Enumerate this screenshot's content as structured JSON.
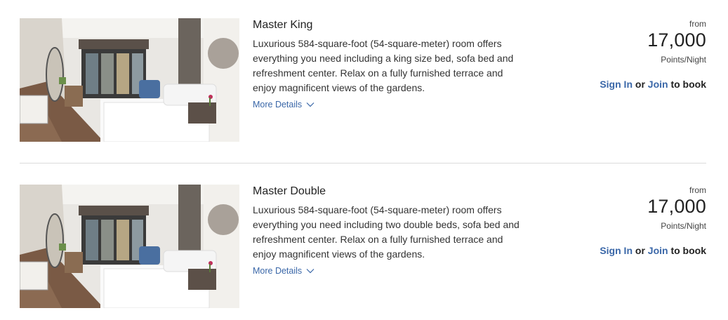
{
  "rooms": [
    {
      "title": "Master King",
      "description": "Luxurious 584-square-foot (54-square-meter) room offers everything you need including a king size bed, sofa bed and refreshment center. Relax on a fully furnished terrace and enjoy magnificent views of the gardens.",
      "more_details": "More Details",
      "price_prefix": "from",
      "price": "17,000",
      "price_unit": "Points/Night",
      "sign_in": "Sign In",
      "or": "or",
      "join": "Join",
      "to_book": "to book"
    },
    {
      "title": "Master Double",
      "description": "Luxurious 584-square-foot (54-square-meter) room offers everything you need including two double beds, sofa bed and refreshment center. Relax on a fully furnished terrace and enjoy magnificent views of the gardens.",
      "more_details": "More Details",
      "price_prefix": "from",
      "price": "17,000",
      "price_unit": "Points/Night",
      "sign_in": "Sign In",
      "or": "or",
      "join": "Join",
      "to_book": "to book"
    }
  ],
  "colors": {
    "link": "#3a67a8",
    "divider": "#dcdcdc"
  },
  "icons": {
    "more_details": "chevron-down-icon"
  }
}
